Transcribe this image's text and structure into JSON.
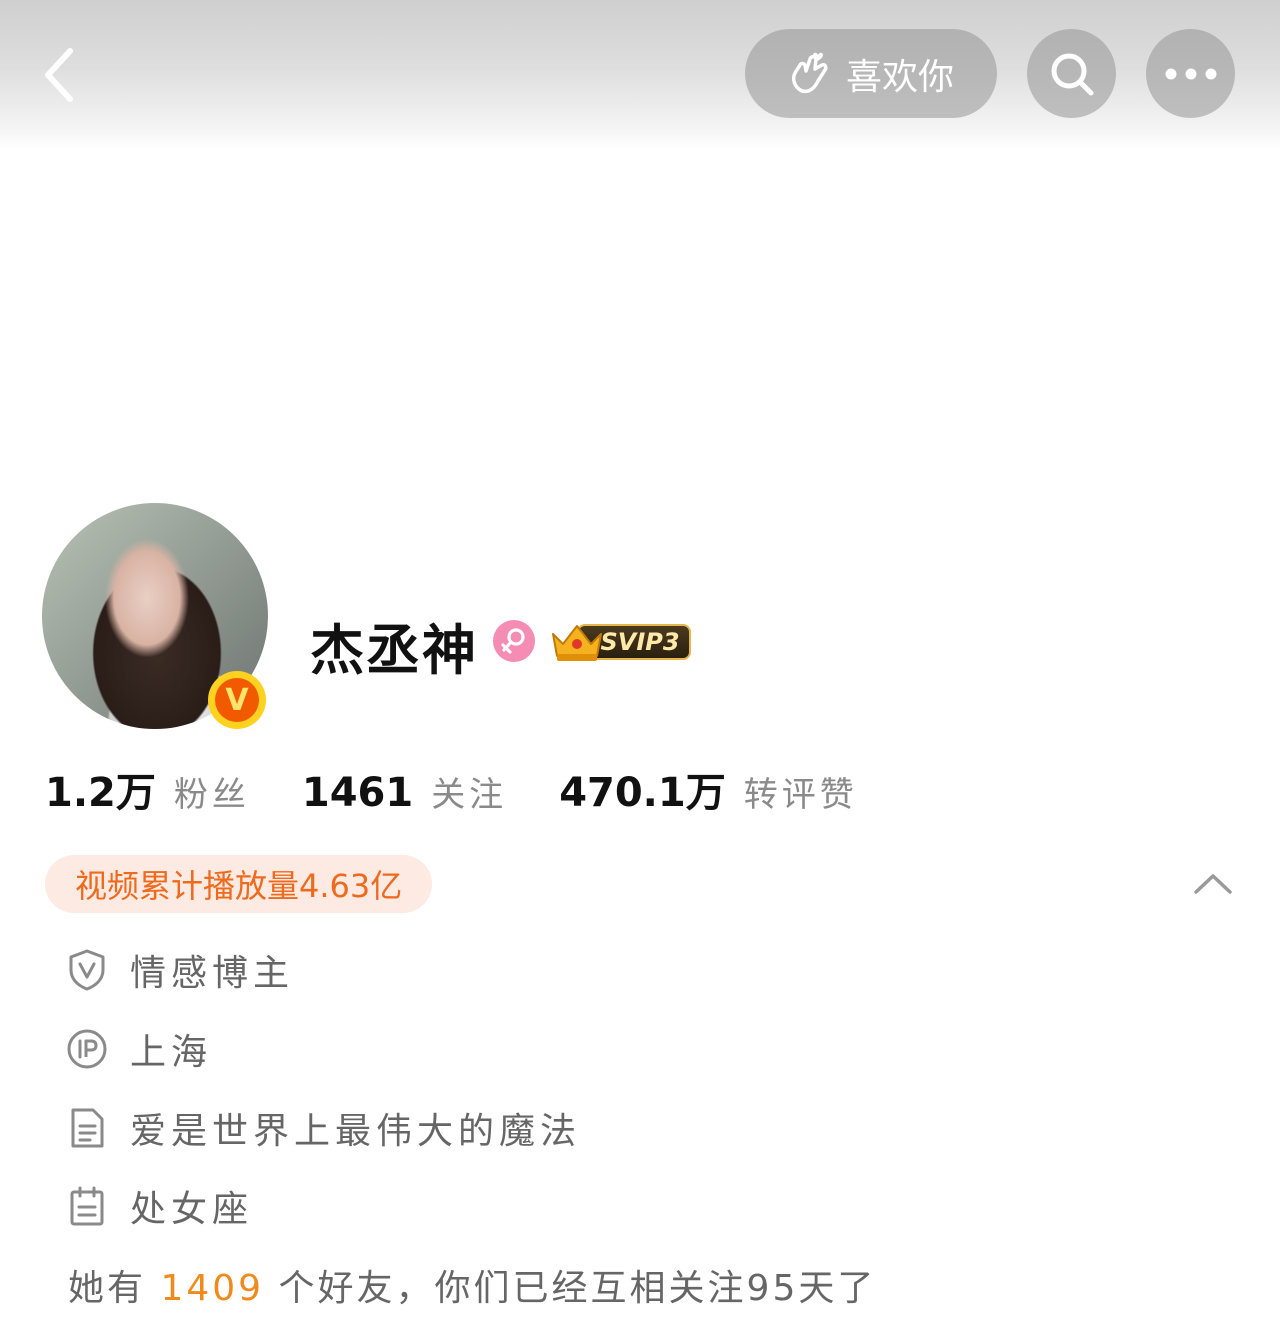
{
  "header": {
    "like_label": "喜欢你"
  },
  "profile": {
    "name": "杰丞神",
    "vip_label": "SVIP3",
    "verified_mark": "V"
  },
  "stats": [
    {
      "value": "1.2万",
      "label": "粉丝"
    },
    {
      "value": "1461",
      "label": "关注"
    },
    {
      "value": "470.1万",
      "label": "转评赞"
    }
  ],
  "play_count": "视频累计播放量4.63亿",
  "info": [
    {
      "icon": "shield-v-icon",
      "text": "情感博主"
    },
    {
      "icon": "ip-icon",
      "text": "上海"
    },
    {
      "icon": "document-icon",
      "text": "爱是世界上最伟大的魔法"
    },
    {
      "icon": "calendar-icon",
      "text": "处女座"
    }
  ],
  "friends": {
    "prefix": "她有",
    "count": "1409",
    "suffix": "个好友，你们已经互相关注95天了"
  },
  "colors": {
    "accent_orange": "#ef6a1d",
    "gender_pink": "#f58cb4",
    "badge_yellow": "#ffd21f"
  }
}
